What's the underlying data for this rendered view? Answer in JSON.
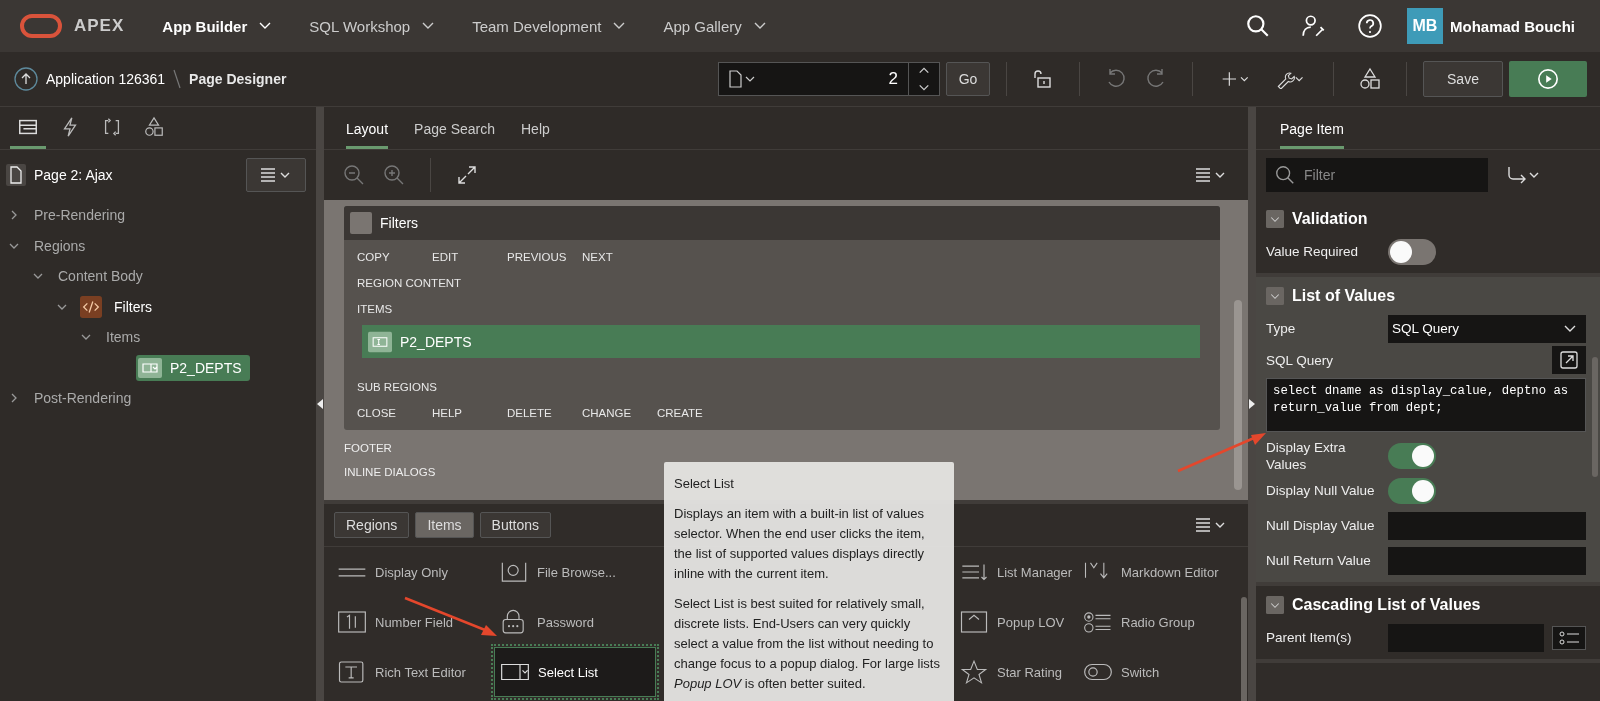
{
  "topbar": {
    "brand": "APEX",
    "menus": [
      {
        "label": "App Builder",
        "selected": true
      },
      {
        "label": "SQL Workshop",
        "selected": false
      },
      {
        "label": "Team Development",
        "selected": false
      },
      {
        "label": "App Gallery",
        "selected": false
      }
    ],
    "user": {
      "initials": "MB",
      "name": "Mohamad Bouchi"
    }
  },
  "toolbar": {
    "breadcrumb": [
      "Application 126361",
      "Page Designer"
    ],
    "page_number": "2",
    "go": "Go",
    "save": "Save"
  },
  "left": {
    "tabs": [
      {
        "selected": true
      },
      {
        "selected": false
      },
      {
        "selected": false
      },
      {
        "selected": false
      }
    ],
    "page": "Page 2: Ajax",
    "tree": [
      {
        "label": "Pre-Rendering",
        "kind": "group",
        "expanded": false,
        "selected": false
      },
      {
        "label": "Regions",
        "kind": "group",
        "expanded": true,
        "selected": false,
        "children": [
          {
            "label": "Content Body",
            "kind": "group",
            "expanded": true,
            "selected": false,
            "children": [
              {
                "label": "Filters",
                "kind": "region",
                "expanded": true,
                "selected": false,
                "children": [
                  {
                    "label": "Items",
                    "kind": "group",
                    "expanded": true,
                    "selected": false,
                    "children": [
                      {
                        "label": "P2_DEPTS",
                        "kind": "item",
                        "selected": true
                      }
                    ]
                  }
                ]
              }
            ]
          }
        ]
      },
      {
        "label": "Post-Rendering",
        "kind": "group",
        "expanded": false,
        "selected": false
      }
    ]
  },
  "designer": {
    "tabs": [
      {
        "label": "Layout",
        "selected": true
      },
      {
        "label": "Page Search",
        "selected": false
      },
      {
        "label": "Help",
        "selected": false
      }
    ],
    "region": {
      "title": "Filters",
      "buttons_top": [
        "COPY",
        "EDIT",
        "PREVIOUS",
        "NEXT"
      ],
      "content_label": "REGION CONTENT",
      "items_label": "ITEMS",
      "item": {
        "label": "P2_DEPTS",
        "selected": true
      },
      "sub_label": "SUB REGIONS",
      "buttons_bottom": [
        "CLOSE",
        "HELP",
        "DELETE",
        "CHANGE",
        "CREATE"
      ]
    },
    "page_positions": [
      "FOOTER",
      "INLINE DIALOGS"
    ],
    "gallery_tabs": [
      {
        "label": "Regions",
        "selected": false
      },
      {
        "label": "Items",
        "selected": true
      },
      {
        "label": "Buttons",
        "selected": false
      }
    ],
    "palette": [
      [
        {
          "label": "Display Only",
          "selected": false
        },
        {
          "label": "Number Field",
          "selected": false
        },
        {
          "label": "Rich Text Editor",
          "selected": false
        }
      ],
      [
        {
          "label": "File Browse...",
          "selected": false
        },
        {
          "label": "Password",
          "selected": false
        },
        {
          "label": "Select List",
          "selected": true
        }
      ],
      [
        {
          "label": "List Manager",
          "selected": false
        },
        {
          "label": "Popup LOV",
          "selected": false
        },
        {
          "label": "Star Rating",
          "selected": false
        }
      ],
      [
        {
          "label": "Markdown Editor",
          "selected": false
        },
        {
          "label": "Radio Group",
          "selected": false
        },
        {
          "label": "Switch",
          "selected": false
        }
      ]
    ],
    "tooltip": {
      "title": "Select List",
      "paragraphs": [
        "Displays an item with a built-in list of values selector. When the end user clicks the item, the list of supported values displays directly inline with the current item.",
        "Select List is best suited for relatively small, discrete lists. End-Users can very quickly select a value from the list without needing to change focus to a popup dialog. For large lists *Popup LOV* is often better suited."
      ]
    }
  },
  "properties": {
    "tabs": [
      {
        "label": "Page Item",
        "selected": true
      }
    ],
    "filter_placeholder": "Filter",
    "sections": [
      {
        "title": "Validation",
        "expanded": true,
        "selected": false,
        "rows": [
          {
            "kind": "toggle",
            "label": "Value Required",
            "on": false
          }
        ]
      },
      {
        "title": "List of Values",
        "expanded": true,
        "selected": true,
        "rows": [
          {
            "kind": "select",
            "label": "Type",
            "value": "SQL Query"
          },
          {
            "kind": "code",
            "label": "SQL Query",
            "value": "select dname as display_calue, deptno as return_value from dept;"
          },
          {
            "kind": "toggle",
            "label": "Display Extra Values",
            "on": true
          },
          {
            "kind": "toggle",
            "label": "Display Null Value",
            "on": true
          },
          {
            "kind": "text",
            "label": "Null Display Value"
          },
          {
            "kind": "text",
            "label": "Null Return Value"
          }
        ]
      },
      {
        "title": "Cascading List of Values",
        "expanded": true,
        "selected": false,
        "rows": [
          {
            "kind": "list",
            "label": "Parent Item(s)"
          }
        ]
      }
    ]
  }
}
